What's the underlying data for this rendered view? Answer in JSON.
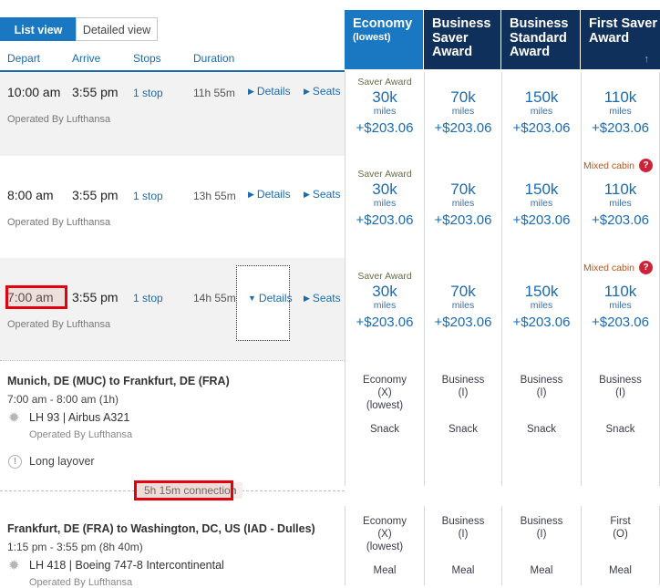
{
  "view_tabs": [
    {
      "label": "List view",
      "active": true
    },
    {
      "label": "Detailed view",
      "active": false
    }
  ],
  "column_headers": {
    "depart": "Depart",
    "arrive": "Arrive",
    "stops": "Stops",
    "duration": "Duration"
  },
  "fare_columns": [
    {
      "title": "Economy",
      "sub": "(lowest)",
      "highlight": true,
      "bg": "#1a78c2"
    },
    {
      "title": "Business Saver Award",
      "sub": "",
      "highlight": false,
      "bg": "#10305c"
    },
    {
      "title": "Business Standard Award",
      "sub": "",
      "highlight": false,
      "bg": "#10305c"
    },
    {
      "title": "First Saver Award",
      "sub": "",
      "highlight": false,
      "bg": "#10305c",
      "sort_arrow": "↑"
    }
  ],
  "flights": [
    {
      "depart": "10:00 am",
      "arrive": "3:55 pm",
      "stops": "1 stop",
      "duration": "11h 55m",
      "details_label": "Details",
      "seats_label": "Seats",
      "operated_by": "Operated By Lufthansa",
      "mixed_cabin": "",
      "fares": [
        {
          "saver_label": "Saver Award",
          "miles": "30k",
          "miles_word": "miles",
          "price": "+$203.06"
        },
        {
          "saver_label": "",
          "miles": "70k",
          "miles_word": "miles",
          "price": "+$203.06"
        },
        {
          "saver_label": "",
          "miles": "150k",
          "miles_word": "miles",
          "price": "+$203.06"
        },
        {
          "saver_label": "",
          "miles": "110k",
          "miles_word": "miles",
          "price": "+$203.06"
        }
      ]
    },
    {
      "depart": "8:00 am",
      "arrive": "3:55 pm",
      "stops": "1 stop",
      "duration": "13h 55m",
      "details_label": "Details",
      "seats_label": "Seats",
      "operated_by": "Operated By Lufthansa",
      "mixed_cabin": "Mixed cabin",
      "help_glyph": "?",
      "fares": [
        {
          "saver_label": "Saver Award",
          "miles": "30k",
          "miles_word": "miles",
          "price": "+$203.06"
        },
        {
          "saver_label": "",
          "miles": "70k",
          "miles_word": "miles",
          "price": "+$203.06"
        },
        {
          "saver_label": "",
          "miles": "150k",
          "miles_word": "miles",
          "price": "+$203.06"
        },
        {
          "saver_label": "",
          "miles": "110k",
          "miles_word": "miles",
          "price": "+$203.06"
        }
      ]
    },
    {
      "depart": "7:00 am",
      "arrive": "3:55 pm",
      "stops": "1 stop",
      "duration": "14h 55m",
      "details_label": "Details",
      "seats_label": "Seats",
      "operated_by": "Operated By Lufthansa",
      "mixed_cabin": "Mixed cabin",
      "help_glyph": "?",
      "expanded": true,
      "fares": [
        {
          "saver_label": "Saver Award",
          "miles": "30k",
          "miles_word": "miles",
          "price": "+$203.06"
        },
        {
          "saver_label": "",
          "miles": "70k",
          "miles_word": "miles",
          "price": "+$203.06"
        },
        {
          "saver_label": "",
          "miles": "150k",
          "miles_word": "miles",
          "price": "+$203.06"
        },
        {
          "saver_label": "",
          "miles": "110k",
          "miles_word": "miles",
          "price": "+$203.06"
        }
      ]
    }
  ],
  "expanded_detail": {
    "segment_1": {
      "route": "Munich, DE (MUC) to Frankfurt, DE (FRA)",
      "times": "7:00 am - 8:00 am (1h)",
      "flight": "LH 93  |  Airbus A321",
      "operated_by": "Operated By Lufthansa",
      "layover_note": "Long layover",
      "info_glyph": "!",
      "star_glyph": "✹",
      "cabins": [
        {
          "name": "Economy",
          "code": "(X)",
          "lowest": "(lowest)",
          "service": "Snack"
        },
        {
          "name": "Business",
          "code": "(I)",
          "lowest": "",
          "service": "Snack"
        },
        {
          "name": "Business",
          "code": "(I)",
          "lowest": "",
          "service": "Snack"
        },
        {
          "name": "Business",
          "code": "(I)",
          "lowest": "",
          "service": "Snack"
        }
      ]
    },
    "connection": "5h 15m connection",
    "segment_2": {
      "route": "Frankfurt, DE (FRA) to Washington, DC, US (IAD - Dulles)",
      "times": "1:15 pm - 3:55 pm (8h 40m)",
      "flight": "LH 418  |  Boeing 747-8 Intercontinental",
      "operated_by": "Operated By Lufthansa",
      "star_glyph": "✹",
      "cabins": [
        {
          "name": "Economy",
          "code": "(X)",
          "lowest": "(lowest)",
          "service": "Meal"
        },
        {
          "name": "Business",
          "code": "(I)",
          "lowest": "",
          "service": "Meal"
        },
        {
          "name": "Business",
          "code": "(I)",
          "lowest": "",
          "service": "Meal"
        },
        {
          "name": "First",
          "code": "(O)",
          "lowest": "",
          "service": "Meal"
        }
      ]
    }
  },
  "annotations": {
    "depart_time_highlight": "7:00 am",
    "connection_highlight": "5h 15m connection"
  },
  "colors": {
    "accent_blue": "#1a78c2",
    "header_navy": "#10305c",
    "link_blue": "#1a6bb0",
    "annotation_red": "#e3000f",
    "mixed_cabin_orange": "#b4541a",
    "help_red": "#cf2237"
  }
}
